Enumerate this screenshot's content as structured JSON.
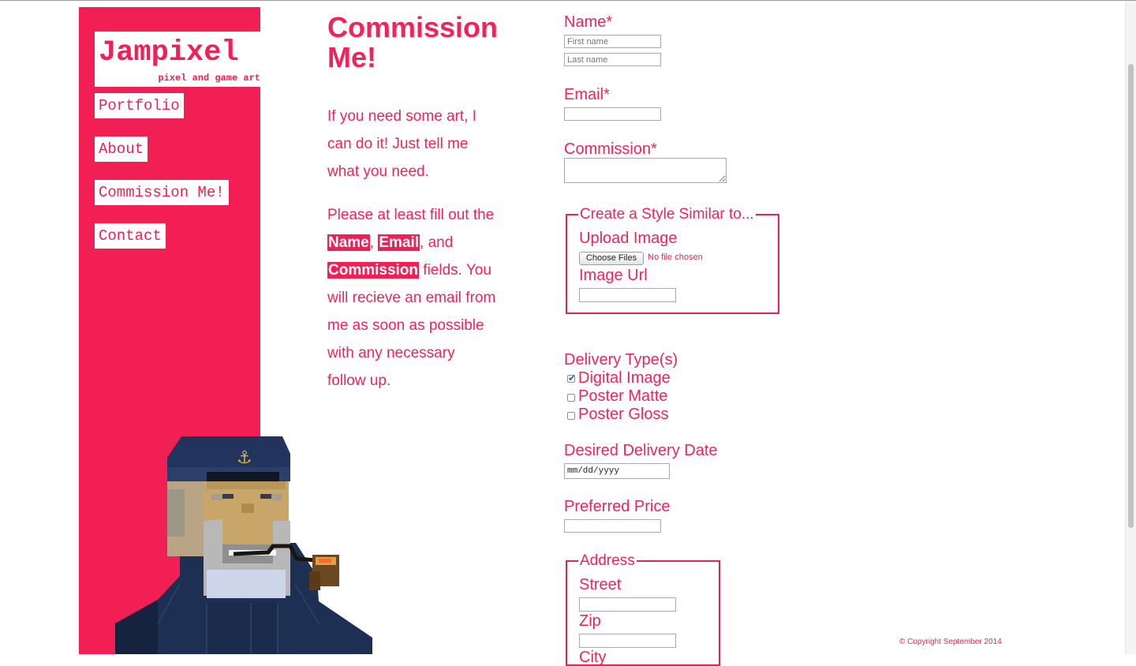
{
  "brand": {
    "title": "Jampixel",
    "tagline": "pixel and game art",
    "accent": "#f21f55"
  },
  "nav": [
    "Portfolio",
    "About",
    "Commission Me!",
    "Contact"
  ],
  "page": {
    "heading": "Commission Me!",
    "intro_1": "If you need some art, I can do it! Just tell me what you need.",
    "intro_2_pre": "Please at least fill out the ",
    "hl_name": "Name",
    "sep_1": ", ",
    "hl_email": "Email",
    "sep_2": ", and ",
    "hl_commission": "Commission",
    "intro_2_post": " fields. You will recieve an email from me as soon as possible with any necessary follow up."
  },
  "form": {
    "name_label": "Name*",
    "first_placeholder": "First name",
    "last_placeholder": "Last name",
    "email_label": "Email*",
    "commission_label": "Commission*",
    "style_legend": "Create a Style Similar to...",
    "upload_label": "Upload Image",
    "choose_files": "Choose Files",
    "no_file": "No file chosen",
    "image_url_label": "Image Url",
    "delivery_label": "Delivery Type(s)",
    "delivery_options": [
      {
        "label": "Digital Image",
        "checked": true
      },
      {
        "label": "Poster Matte",
        "checked": false
      },
      {
        "label": "Poster Gloss",
        "checked": false
      }
    ],
    "date_label": "Desired Delivery Date",
    "date_placeholder": "mm/dd/yyyy",
    "price_label": "Preferred Price",
    "address_legend": "Address",
    "street_label": "Street",
    "zip_label": "Zip",
    "city_label": "City"
  },
  "footer": {
    "copyright": "© Copyright September 2014"
  }
}
